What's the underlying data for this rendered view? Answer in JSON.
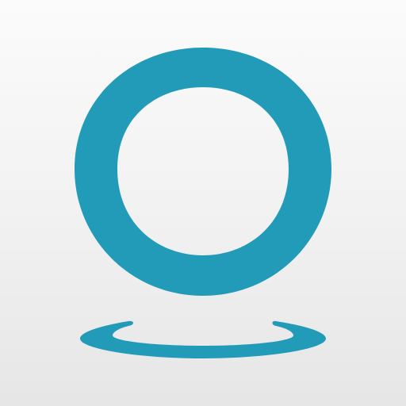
{
  "icon": {
    "name": "ring-logo-app-icon",
    "accent_color": "#229bb8",
    "background_color": "#f2f2f2"
  }
}
